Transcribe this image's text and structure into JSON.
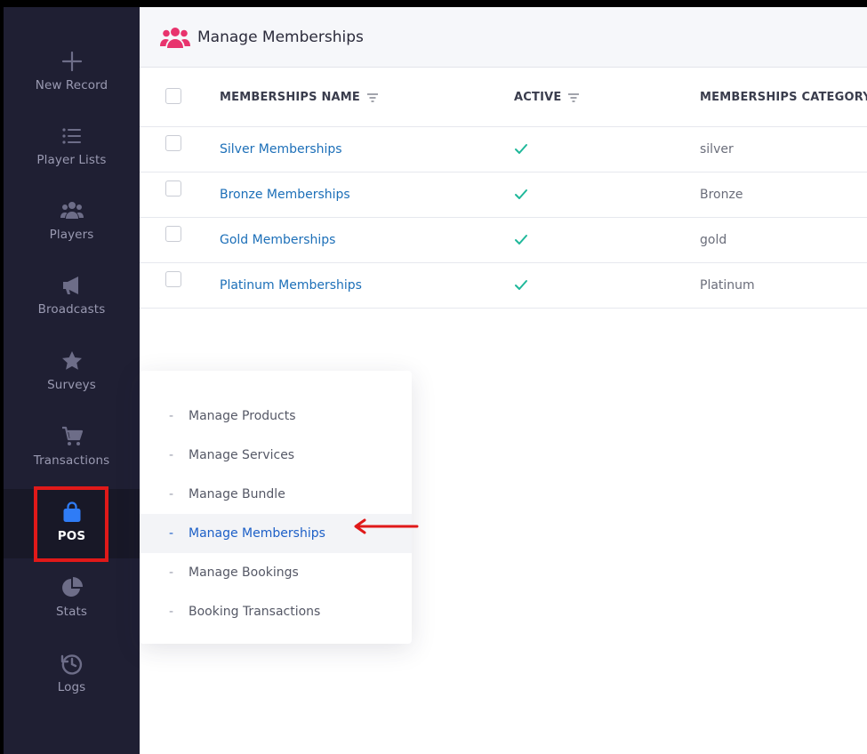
{
  "sidebar": {
    "items": [
      {
        "label": "New Record",
        "icon": "plus-icon"
      },
      {
        "label": "Player Lists",
        "icon": "list-icon"
      },
      {
        "label": "Players",
        "icon": "users-icon"
      },
      {
        "label": "Broadcasts",
        "icon": "megaphone-icon"
      },
      {
        "label": "Surveys",
        "icon": "star-icon"
      },
      {
        "label": "Transactions",
        "icon": "cart-icon"
      },
      {
        "label": "POS",
        "icon": "shopping-bag-icon",
        "active": true
      },
      {
        "label": "Stats",
        "icon": "pie-chart-icon"
      },
      {
        "label": "Logs",
        "icon": "history-icon"
      }
    ]
  },
  "header": {
    "title": "Manage Memberships",
    "icon": "users-icon"
  },
  "table": {
    "columns": [
      "MEMBERSHIPS NAME",
      "ACTIVE",
      "MEMBERSHIPS CATEGORY"
    ],
    "rows": [
      {
        "name": "Silver Memberships",
        "active": true,
        "category": "silver"
      },
      {
        "name": "Bronze Memberships",
        "active": true,
        "category": "Bronze"
      },
      {
        "name": "Gold Memberships",
        "active": true,
        "category": "gold"
      },
      {
        "name": "Platinum Memberships",
        "active": true,
        "category": "Platinum"
      }
    ]
  },
  "pos_menu": {
    "items": [
      {
        "label": "Manage Products"
      },
      {
        "label": "Manage Services"
      },
      {
        "label": "Manage Bundle"
      },
      {
        "label": "Manage Memberships",
        "selected": true
      },
      {
        "label": "Manage Bookings"
      },
      {
        "label": "Booking Transactions"
      }
    ],
    "dash": "-"
  },
  "colors": {
    "sidebar_bg": "#1f1f33",
    "accent_blue": "#1c5fc7",
    "link_blue": "#1c6fb8",
    "header_icon": "#e8336d",
    "pos_icon": "#2f7cf6",
    "check_green": "#1fb89a",
    "annotation_red": "#e01919"
  }
}
